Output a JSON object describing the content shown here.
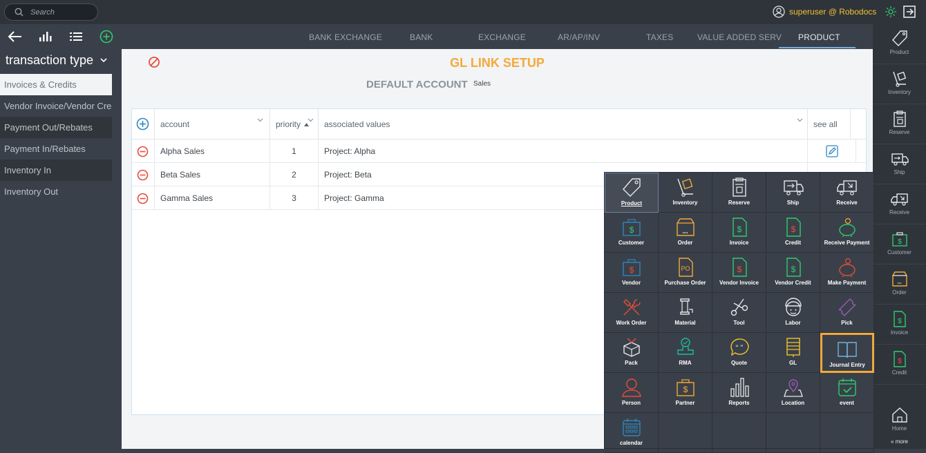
{
  "topbar": {
    "search_placeholder": "Search",
    "user": "superuser @ Robodocs"
  },
  "sidebar": {
    "transaction_title": "transaction type",
    "items": [
      "Invoices & Credits",
      "Vendor Invoice/Vendor Credit",
      "Payment Out/Rebates",
      "Payment In/Rebates",
      "Inventory In",
      "Inventory Out"
    ]
  },
  "tabs": [
    "BANK EXCHANGE",
    "BANK",
    "EXCHANGE",
    "AR/AP/INV",
    "TAXES",
    "VALUE ADDED SERV",
    "PRODUCT"
  ],
  "main": {
    "title": "GL LINK SETUP",
    "default_account_label": "DEFAULT ACCOUNT",
    "default_account_value": "Sales"
  },
  "grid": {
    "headers": {
      "account": "account",
      "priority": "priority",
      "associated": "associated values",
      "see_all": "see all"
    },
    "rows": [
      {
        "account": "Alpha Sales",
        "priority": "1",
        "values": "Project: Alpha"
      },
      {
        "account": "Beta Sales",
        "priority": "2",
        "values": "Project: Beta"
      },
      {
        "account": "Gamma Sales",
        "priority": "3",
        "values": "Project: Gamma"
      }
    ]
  },
  "popup": {
    "items": [
      "Product",
      "Inventory",
      "Reserve",
      "Ship",
      "Receive",
      "Customer",
      "Order",
      "Invoice",
      "Credit",
      "Receive Payment",
      "Vendor",
      "Purchase Order",
      "Vendor Invoice",
      "Vendor Credit",
      "Make Payment",
      "Work Order",
      "Material",
      "Tool",
      "Labor",
      "Pick",
      "Pack",
      "RMA",
      "Quote",
      "GL",
      "Journal Entry",
      "Person",
      "Partner",
      "Reports",
      "Location",
      "event",
      "calendar"
    ]
  },
  "rightbar": {
    "items": [
      "Product",
      "Inventory",
      "Reserve",
      "Ship",
      "Receive",
      "Customer",
      "Order",
      "Invoice",
      "Credit",
      "Home"
    ],
    "more": "« more"
  },
  "colors": {
    "accent": "#f4a93a",
    "blue": "#2e86c1",
    "red": "#e74c3c",
    "green": "#2ecc71",
    "user": "#f1c232"
  }
}
